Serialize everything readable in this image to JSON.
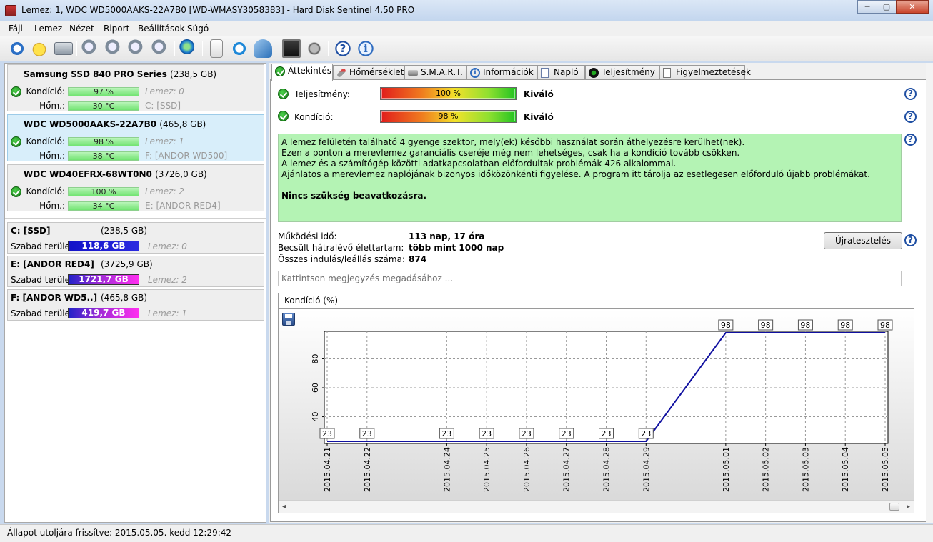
{
  "window": {
    "title": "Lemez: 1, WDC WD5000AAKS-22A7B0 [WD-WMASY3058383]  -  Hard Disk Sentinel 4.50 PRO",
    "minimize": "─",
    "maximize": "▢",
    "close": "✕"
  },
  "menu": [
    {
      "label": "Fájl"
    },
    {
      "label": "Lemez"
    },
    {
      "label": "Nézet"
    },
    {
      "label": "Riport"
    },
    {
      "label": "Beállítások"
    },
    {
      "label": "Súgó"
    }
  ],
  "toolbar": {
    "icons": [
      "refresh-icon",
      "warning-icon",
      "disk-icon",
      "tool-icon",
      "tool-icon",
      "tool-icon",
      "tool-icon",
      "globe-icon",
      "document-icon",
      "sync-icon",
      "network-icon",
      "monitor-icon",
      "speaker-icon",
      "help-icon",
      "info-icon"
    ],
    "help_glyph": "?",
    "info_glyph": "i"
  },
  "disks": [
    {
      "name": "Samsung SSD 840 PRO Series",
      "size": "(238,5 GB)",
      "condition_label": "Kondíció:",
      "condition": "97 %",
      "condition_pct": 97,
      "temp_label": "Hőm.:",
      "temp": "30 °C",
      "disk_ref": "Lemez: 0",
      "partition": "C: [SSD]"
    },
    {
      "name": "WDC WD5000AAKS-22A7B0",
      "size": "(465,8 GB)",
      "condition_label": "Kondíció:",
      "condition": "98 %",
      "condition_pct": 98,
      "temp_label": "Hőm.:",
      "temp": "38 °C",
      "disk_ref": "Lemez: 1",
      "partition": "F: [ANDOR WD500]"
    },
    {
      "name": "WDC WD40EFRX-68WT0N0",
      "size": "(3726,0 GB)",
      "condition_label": "Kondíció:",
      "condition": "100 %",
      "condition_pct": 100,
      "temp_label": "Hőm.:",
      "temp": "34 °C",
      "disk_ref": "Lemez: 2",
      "partition": "E: [ANDOR RED4]"
    }
  ],
  "partitions": [
    {
      "name": "C: [SSD]",
      "size": "(238,5 GB)",
      "free_label": "Szabad terület",
      "free": "118,6 GB",
      "disk_ref": "Lemez: 0"
    },
    {
      "name": "E: [ANDOR RED4]",
      "size": "(3725,9 GB)",
      "free_label": "Szabad terület",
      "free": "1721,7 GB",
      "disk_ref": "Lemez: 2"
    },
    {
      "name": "F: [ANDOR WD5..]",
      "size": "(465,8 GB)",
      "free_label": "Szabad terület",
      "free": "419,7 GB",
      "disk_ref": "Lemez: 1"
    }
  ],
  "tabs": [
    {
      "label": "Áttekintés",
      "active": true,
      "icon": "check-icon"
    },
    {
      "label": "Hőmérséklet",
      "active": false,
      "icon": "thermometer-icon"
    },
    {
      "label": "S.M.A.R.T.",
      "active": false,
      "icon": "disk-icon"
    },
    {
      "label": "Információk",
      "active": false,
      "icon": "info-icon"
    },
    {
      "label": "Napló",
      "active": false,
      "icon": "log-icon"
    },
    {
      "label": "Teljesítmény",
      "active": false,
      "icon": "gauge-icon"
    },
    {
      "label": "Figyelmeztetések",
      "active": false,
      "icon": "alerts-icon"
    }
  ],
  "overview": {
    "performance_label": "Teljesítmény:",
    "performance_value": "100 %",
    "performance_rating": "Kiváló",
    "condition_label": "Kondíció:",
    "condition_value": "98 %",
    "condition_rating": "Kiváló",
    "help_glyph": "?",
    "message_lines": [
      "A lemez felületén található 4 gyenge szektor, mely(ek) későbbi használat során áthelyezésre kerülhet(nek).",
      "Ezen a ponton a merevlemez garanciális cseréje még nem lehetséges, csak ha a kondíció tovább csökken.",
      "A lemez és a számítógép közötti adatkapcsolatban előfordultak problémák 426 alkalommal.",
      "Ajánlatos a merevlemez naplójának bizonyos időközönkénti figyelése. A program itt tárolja az esetlegesen előforduló újabb problémákat."
    ],
    "message_strong": "Nincs szükség beavatkozásra.",
    "uptime_label": "Működési idő:",
    "uptime_value": "113 nap, 17 óra",
    "remaining_label": "Becsült hátralévő élettartam:",
    "remaining_value": "több mint 1000 nap",
    "starts_label": "Összes indulás/leállás száma:",
    "starts_value": "874",
    "retest_button": "Újratesztelés",
    "note_placeholder": "Kattintson megjegyzés megadásához ..."
  },
  "chart_tab": "Kondíció  (%)",
  "chart_data": {
    "type": "line",
    "title": "",
    "xlabel": "",
    "ylabel": "",
    "x": [
      "2015.04.21",
      "2015.04.22",
      "2015.04.24",
      "2015.04.25",
      "2015.04.26",
      "2015.04.27",
      "2015.04.28",
      "2015.04.29",
      "2015.05.01",
      "2015.05.02",
      "2015.05.03",
      "2015.05.04",
      "2015.05.05"
    ],
    "values": [
      23,
      23,
      23,
      23,
      23,
      23,
      23,
      23,
      98,
      98,
      98,
      98,
      98
    ],
    "ylim": [
      23,
      98
    ],
    "yticks": [
      40,
      60,
      80
    ],
    "grid": true,
    "color": "#1010a0"
  },
  "status": "Állapot utoljára frissítve: 2015.05.05. kedd 12:29:42"
}
